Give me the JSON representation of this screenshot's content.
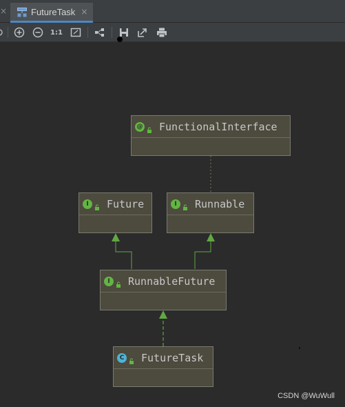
{
  "tab": {
    "title": "FutureTask",
    "close": "×"
  },
  "tab_prev_close": "×",
  "toolbar": {
    "icons": [
      "zoom-in-icon",
      "zoom-out-icon",
      "actual-size-icon",
      "fit-content-icon",
      "layout-icon",
      "save-icon",
      "export-icon",
      "print-icon"
    ],
    "actual_size_label": "1:1"
  },
  "diagram": {
    "nodes": [
      {
        "id": "functional-interface",
        "kind": "@",
        "label": "FunctionalInterface"
      },
      {
        "id": "future",
        "kind": "I",
        "label": "Future"
      },
      {
        "id": "runnable",
        "kind": "I",
        "label": "Runnable"
      },
      {
        "id": "runnable-future",
        "kind": "I",
        "label": "RunnableFuture"
      },
      {
        "id": "future-task",
        "kind": "C",
        "label": "FutureTask"
      }
    ],
    "colors": {
      "node_fill": "#4d4a3e",
      "interface_badge": "#62b543",
      "class_badge": "#4eb3d4",
      "annotation_badge": "#62b543",
      "arrow": "#62a743"
    }
  },
  "watermark": "CSDN @WuWull"
}
